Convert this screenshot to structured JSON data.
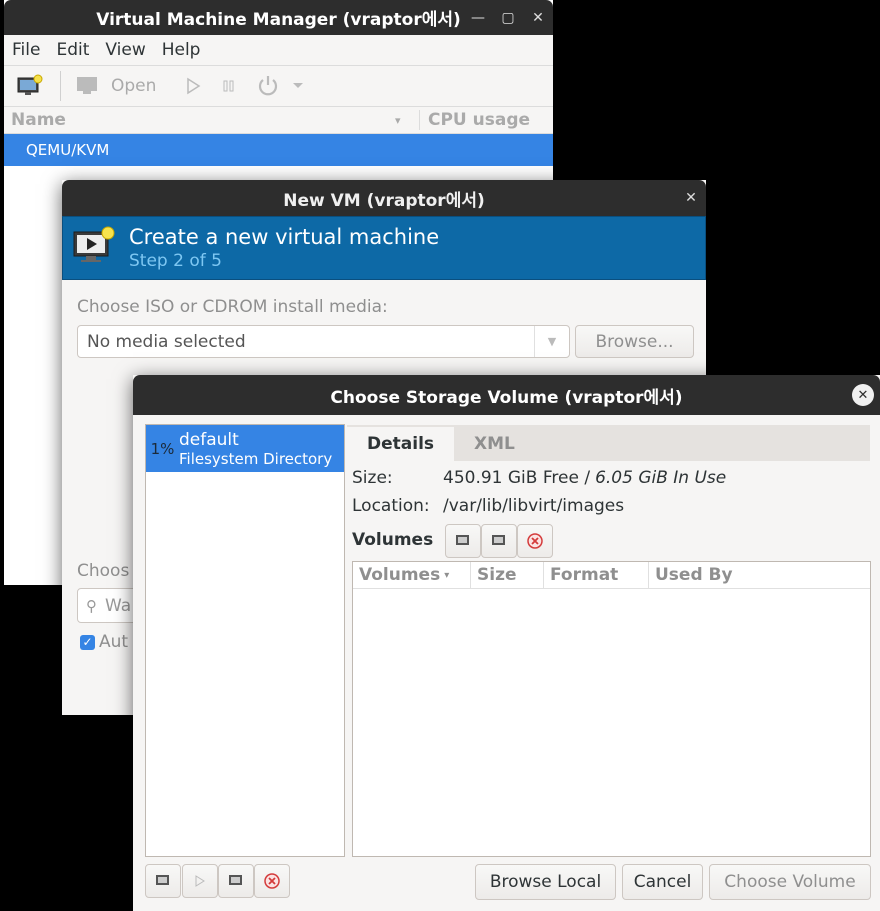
{
  "main_window": {
    "title": "Virtual Machine Manager (vraptor에서)",
    "menu": [
      "File",
      "Edit",
      "View",
      "Help"
    ],
    "toolbar": {
      "open_label": "Open"
    },
    "columns": {
      "name": "Name",
      "cpu": "CPU usage"
    },
    "connection": "QEMU/KVM"
  },
  "new_vm": {
    "title": "New VM (vraptor에서)",
    "banner_title": "Create a new virtual machine",
    "banner_step": "Step 2 of 5",
    "media_label": "Choose ISO or CDROM install media:",
    "media_value": "No media selected",
    "browse_label": "Browse...",
    "os_label_partial": "Choos",
    "os_search_partial": "Wa",
    "auto_label_partial": "Aut",
    "auto_checked": true
  },
  "storage_dialog": {
    "title": "Choose Storage Volume (vraptor에서)",
    "pool": {
      "usage": "1%",
      "name": "default",
      "type": "Filesystem Directory"
    },
    "tabs": [
      "Details",
      "XML"
    ],
    "size_label": "Size:",
    "size_free": "450.91 GiB Free / ",
    "size_used": "6.05 GiB In Use",
    "location_label": "Location:",
    "location_value": "/var/lib/libvirt/images",
    "volumes_label": "Volumes",
    "volume_columns": [
      "Volumes",
      "Size",
      "Format",
      "Used By"
    ],
    "buttons": {
      "browse_local": "Browse Local",
      "cancel": "Cancel",
      "choose": "Choose Volume"
    }
  },
  "colors": {
    "selection": "#3584e4",
    "banner": "#0d69a6",
    "titlebar": "#2d2d2d"
  }
}
